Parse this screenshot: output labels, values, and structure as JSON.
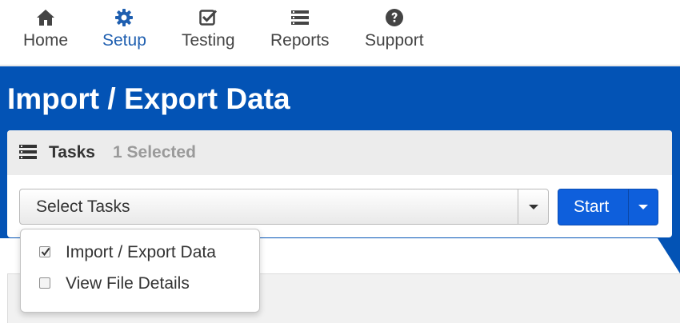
{
  "nav": {
    "items": [
      {
        "label": "Home",
        "icon": "home-icon"
      },
      {
        "label": "Setup",
        "icon": "gear-icon"
      },
      {
        "label": "Testing",
        "icon": "check-square-icon"
      },
      {
        "label": "Reports",
        "icon": "list-icon"
      },
      {
        "label": "Support",
        "icon": "question-circle-icon"
      }
    ],
    "active": "Setup"
  },
  "page": {
    "title": "Import / Export Data"
  },
  "tasks": {
    "title": "Tasks",
    "selected_count": "1 Selected",
    "select_placeholder": "Select Tasks",
    "start_label": "Start",
    "options": [
      {
        "label": "Import / Export Data",
        "checked": true
      },
      {
        "label": "View File Details",
        "checked": false
      }
    ]
  },
  "colors": {
    "banner": "#0353b5",
    "active_nav": "#1f5fb0",
    "start_button": "#0e5fdc",
    "selected_count": "#9a9a9a"
  }
}
